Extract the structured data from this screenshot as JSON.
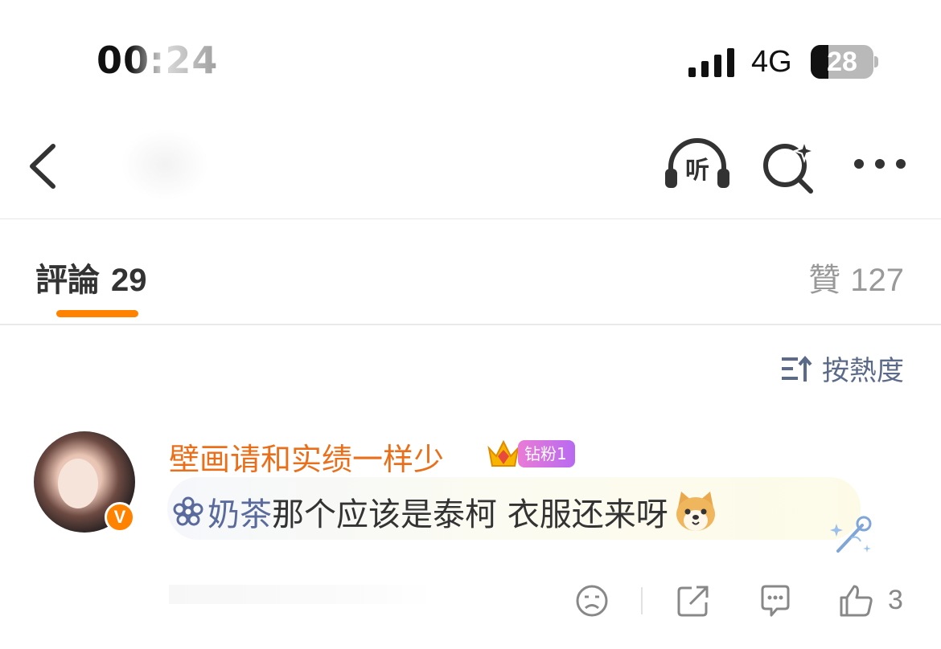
{
  "status_bar": {
    "time": "00:24",
    "network": "4G",
    "battery": "28",
    "battery_level": 0.28
  },
  "nav": {
    "listen_label": "听"
  },
  "tabs": {
    "comments_label": "評論",
    "comments_count": "29",
    "likes_label": "贊",
    "likes_count": "127"
  },
  "sort": {
    "label": "按熱度"
  },
  "comment": {
    "username": "壁画请和实绩一样少",
    "fan_badge": "钻粉1",
    "mention": "奶茶",
    "text": "那个应该是泰柯 衣服还来呀",
    "avatar_badge": "V",
    "like_count": "3"
  },
  "colors": {
    "accent": "#ff8200",
    "username": "#ea6f1a",
    "mention": "#5a6a9c"
  }
}
